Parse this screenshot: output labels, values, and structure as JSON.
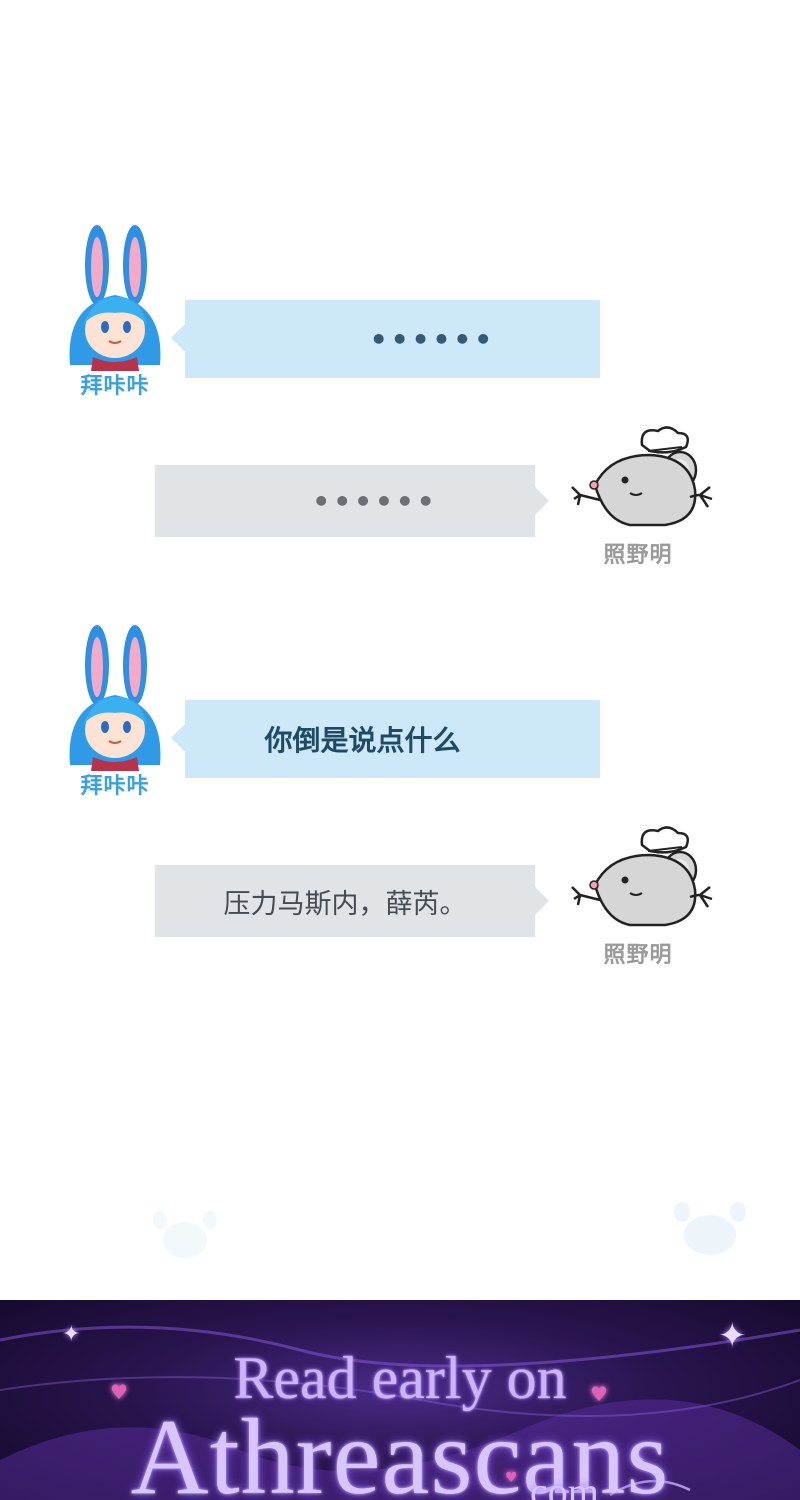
{
  "chat": {
    "messages": [
      {
        "side": "left",
        "speaker": "拜咔咔",
        "text": "……",
        "dots": "••••••"
      },
      {
        "side": "right",
        "speaker": "照野明",
        "text": "……",
        "dots": "••••••"
      },
      {
        "side": "left",
        "speaker": "拜咔咔",
        "text": "你倒是说点什么"
      },
      {
        "side": "right",
        "speaker": "照野明",
        "text": "压力马斯内，薛芮。"
      }
    ],
    "avatars": {
      "left": "bunny-avatar",
      "right": "mouse-avatar"
    }
  },
  "banner": {
    "line1": "Read early on",
    "line2": "Athreascans",
    "line3": ".com"
  },
  "colors": {
    "left_bubble": "#cde8f8",
    "right_bubble": "#e1e4e7",
    "bunny_name": "#3aa0e6",
    "mouse_name": "#9a9a9a",
    "banner_text": "#d8c6fa"
  }
}
